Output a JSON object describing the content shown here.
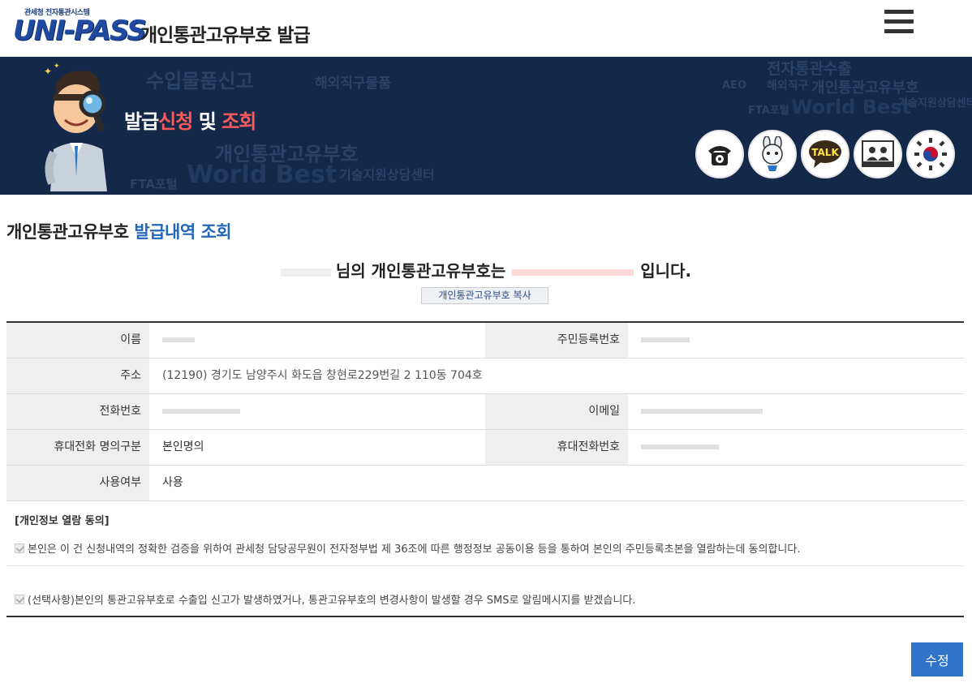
{
  "header": {
    "logo_sub": "관세청 전자통관시스템",
    "logo_main": "UNI-PASS",
    "title": "개인통관고유부호  발급",
    "menu_icon": "hamburger-menu-icon"
  },
  "banner": {
    "title_part1": "발급",
    "title_part2": "신청",
    "title_part3": " 및 ",
    "title_part4": "조회",
    "background_words": [
      "수입물품신고",
      "해외직구물품",
      "개인통관고유부호",
      "World Best",
      "기술지원상담센터",
      "FTA포털",
      "전자통관수출",
      "AEO",
      "해외직구"
    ],
    "circle_icons": [
      "telephone-icon",
      "chatbot-character-icon",
      "kakao-talk-icon",
      "remote-support-icon",
      "government-emblem-icon"
    ],
    "talk_label": "TALK"
  },
  "section": {
    "title_part1": "개인통관고유부호 ",
    "title_part2": "발급내역 조회"
  },
  "result": {
    "text_middle": "님의 개인통관고유부호는",
    "text_end": "입니다.",
    "copy_button": "개인통관고유부호 복사"
  },
  "table": {
    "name_label": "이름",
    "rrn_label": "주민등록번호",
    "address_label": "주소",
    "address_value": "(12190) 경기도 남양주시 화도읍 창현로229번길 2 110동 704호",
    "phone_label": "전화번호",
    "email_label": "이메일",
    "mobile_type_label": "휴대전화 명의구분",
    "mobile_type_value": "본인명의",
    "mobile_label": "휴대전화번호",
    "usage_label": "사용여부",
    "usage_value": "사용"
  },
  "consent": {
    "title": "[개인정보 열람 동의]",
    "item1": "본인은 이 건 신청내역의 정확한 검증을 위하여 관세청 담당공무원이 전자정부법 제 36조에 따른 행정정보 공동이용 등을 통하여 본인의 주민등록초본을 열람하는데 동의합니다.",
    "item2": "(선택사항)본인의 통관고유부호로 수출입 신고가 발생하였거나, 통관고유부호의 변경사항이 발생할 경우 SMS로 알림메시지를 받겠습니다."
  },
  "actions": {
    "edit_button": "수정"
  },
  "colors": {
    "banner_bg": "#14284a",
    "accent_blue": "#2366b6",
    "highlight_red": "#ff5a5a",
    "button_blue": "#2f74c9"
  }
}
